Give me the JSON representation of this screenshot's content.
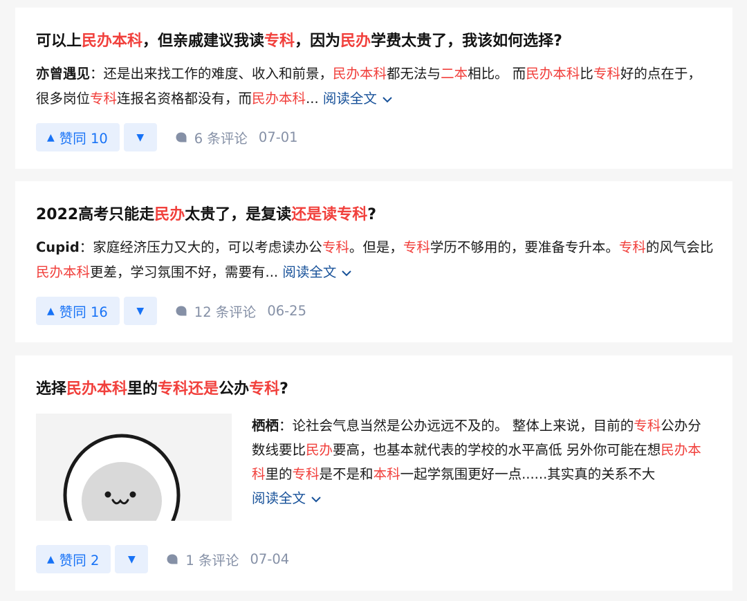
{
  "cards": [
    {
      "title_parts": [
        {
          "t": "可以上",
          "hl": false
        },
        {
          "t": "民办本科",
          "hl": true
        },
        {
          "t": "，但亲戚建议我读",
          "hl": false
        },
        {
          "t": "专科",
          "hl": true
        },
        {
          "t": "，因为",
          "hl": false
        },
        {
          "t": "民办",
          "hl": true
        },
        {
          "t": "学费太贵了，我该如何选择?",
          "hl": false
        }
      ],
      "author": "亦曾遇见",
      "excerpt_parts": [
        {
          "t": "：还是出来找工作的难度、收入和前景，",
          "hl": false
        },
        {
          "t": "民办本科",
          "hl": true
        },
        {
          "t": "都无法与",
          "hl": false
        },
        {
          "t": "二本",
          "hl": true
        },
        {
          "t": "相比。 而",
          "hl": false
        },
        {
          "t": "民办本科",
          "hl": true
        },
        {
          "t": "比",
          "hl": false
        },
        {
          "t": "专科",
          "hl": true
        },
        {
          "t": "好的点在于，很多岗位",
          "hl": false
        },
        {
          "t": "专科",
          "hl": true
        },
        {
          "t": "连报名资格都没有，而",
          "hl": false
        },
        {
          "t": "民办本科",
          "hl": true
        },
        {
          "t": "...",
          "hl": false
        }
      ],
      "read_more": "阅读全文",
      "vote_label": "赞同 10",
      "comments": "6 条评论",
      "date": "07-01"
    },
    {
      "title_parts": [
        {
          "t": "2022高考只能走",
          "hl": false
        },
        {
          "t": "民办",
          "hl": true
        },
        {
          "t": "太贵了，是复读",
          "hl": false
        },
        {
          "t": "还是读专科",
          "hl": true
        },
        {
          "t": "?",
          "hl": false
        }
      ],
      "author": "Cupid",
      "excerpt_parts": [
        {
          "t": "：家庭经济压力又大的，可以考虑读办公",
          "hl": false
        },
        {
          "t": "专科",
          "hl": true
        },
        {
          "t": "。但是，",
          "hl": false
        },
        {
          "t": "专科",
          "hl": true
        },
        {
          "t": "学历不够用的，要准备专升本。",
          "hl": false
        },
        {
          "t": "专科",
          "hl": true
        },
        {
          "t": "的风气会比",
          "hl": false
        },
        {
          "t": "民办本科",
          "hl": true
        },
        {
          "t": "更差，学习氛围不好，需要有...",
          "hl": false
        }
      ],
      "read_more": "阅读全文",
      "vote_label": "赞同 16",
      "comments": "12 条评论",
      "date": "06-25"
    },
    {
      "title_parts": [
        {
          "t": "选择",
          "hl": false
        },
        {
          "t": "民办本科",
          "hl": true
        },
        {
          "t": "里的",
          "hl": false
        },
        {
          "t": "专科还是",
          "hl": true
        },
        {
          "t": "公办",
          "hl": false
        },
        {
          "t": "专科",
          "hl": true
        },
        {
          "t": "?",
          "hl": false
        }
      ],
      "author": "栖栖",
      "excerpt_parts": [
        {
          "t": "：论社会气息当然是公办远远不及的。 整体上来说，目前的",
          "hl": false
        },
        {
          "t": "专科",
          "hl": true
        },
        {
          "t": "公办分数线要比",
          "hl": false
        },
        {
          "t": "民办",
          "hl": true
        },
        {
          "t": "要高，也基本就代表的学校的水平高低 另外你可能在想",
          "hl": false
        },
        {
          "t": "民办本科",
          "hl": true
        },
        {
          "t": "里的",
          "hl": false
        },
        {
          "t": "专科",
          "hl": true
        },
        {
          "t": "是不是和",
          "hl": false
        },
        {
          "t": "本科",
          "hl": true
        },
        {
          "t": "一起学氛围更好一点......其实真的关系不大",
          "hl": false
        }
      ],
      "read_more": "阅读全文",
      "vote_label": "赞同 2",
      "comments": "1 条评论",
      "date": "07-04",
      "thumbnail": "cartoon-face"
    }
  ],
  "colors": {
    "highlight": "#f1403c",
    "link": "#175199",
    "vote_bg": "#e8f0fd",
    "vote_text": "#1772f6",
    "meta": "#8590a6",
    "page_bg": "#f6f6f6"
  }
}
